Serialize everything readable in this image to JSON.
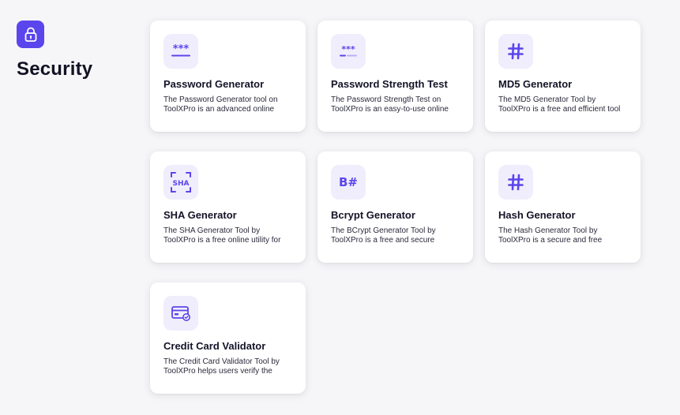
{
  "category": {
    "title": "Security",
    "icon": "lock-icon"
  },
  "colors": {
    "accent": "#5b45ec",
    "icon_bg": "#f0eefc",
    "page_bg": "#f6f6f8",
    "card_bg": "#ffffff"
  },
  "tools": [
    {
      "icon": "asterisks-icon",
      "title": "Password Generator",
      "desc": "The Password Generator tool on ToolXPro is an advanced online"
    },
    {
      "icon": "asterisks-strength-icon",
      "title": "Password Strength Test",
      "desc": "The Password Strength Test on ToolXPro is an easy-to-use online"
    },
    {
      "icon": "hash-icon",
      "title": "MD5 Generator",
      "desc": "The MD5 Generator Tool by ToolXPro is a free and efficient tool"
    },
    {
      "icon": "sha-scan-icon",
      "icon_text": "SHA",
      "title": "SHA Generator",
      "desc": "The SHA Generator Tool by ToolXPro is a free online utility for"
    },
    {
      "icon": "b-sharp-icon",
      "icon_text": "B#",
      "title": "Bcrypt Generator",
      "desc": "The BCrypt Generator Tool by ToolXPro is a free and secure"
    },
    {
      "icon": "hash-icon",
      "title": "Hash Generator",
      "desc": "The Hash Generator Tool by ToolXPro is a secure and free"
    },
    {
      "icon": "credit-card-check-icon",
      "title": "Credit Card Validator",
      "desc": "The Credit Card Validator Tool by ToolXPro helps users verify the"
    }
  ]
}
